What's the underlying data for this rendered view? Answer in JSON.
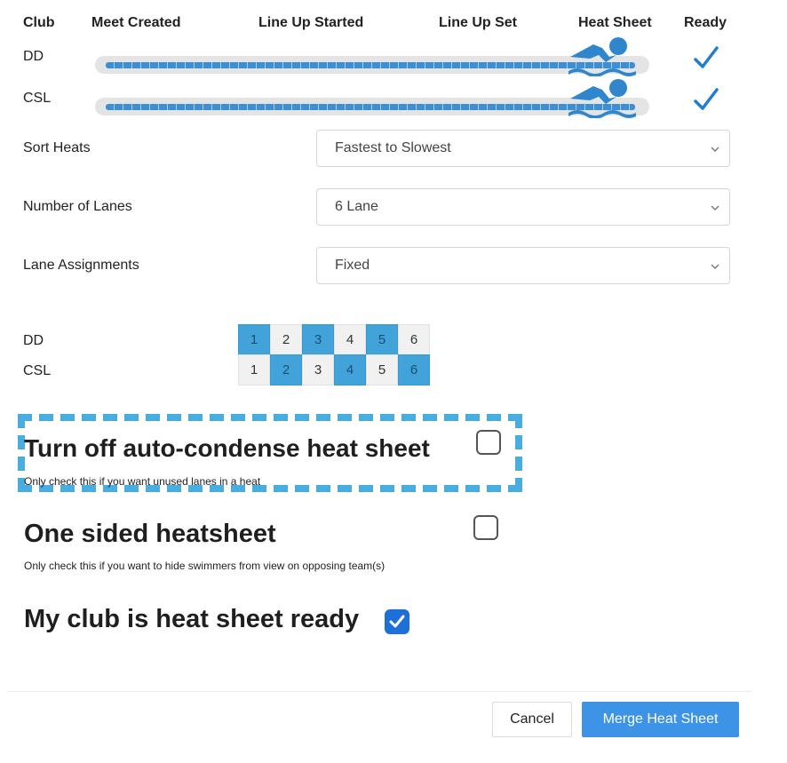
{
  "headers": {
    "club": "Club",
    "meet_created": "Meet Created",
    "lineup_started": "Line Up Started",
    "lineup_set": "Line Up Set",
    "heat_sheet": "Heat Sheet",
    "ready": "Ready"
  },
  "clubs": [
    {
      "name": "DD",
      "progress": 1.0,
      "ready": true
    },
    {
      "name": "CSL",
      "progress": 1.0,
      "ready": true
    }
  ],
  "settings": {
    "sort_heats": {
      "label": "Sort Heats",
      "value": "Fastest to Slowest"
    },
    "num_lanes": {
      "label": "Number of Lanes",
      "value": "6 Lane"
    },
    "lane_assignments": {
      "label": "Lane Assignments",
      "value": "Fixed"
    }
  },
  "lanes": {
    "numbers": [
      "1",
      "2",
      "3",
      "4",
      "5",
      "6"
    ],
    "rows": [
      {
        "club": "DD",
        "selected": [
          1,
          3,
          5
        ]
      },
      {
        "club": "CSL",
        "selected": [
          2,
          4,
          6
        ]
      }
    ]
  },
  "options": {
    "auto_condense": {
      "label": "Turn off auto-condense heat sheet",
      "hint": "Only check this if you want unused lanes in a heat",
      "checked": false
    },
    "one_sided": {
      "label": "One sided heatsheet",
      "hint": "Only check this if you want to hide swimmers from view on opposing team(s)",
      "checked": false
    },
    "club_ready": {
      "label": "My club is heat sheet ready",
      "checked": true
    }
  },
  "buttons": {
    "cancel": "Cancel",
    "merge": "Merge Heat Sheet"
  },
  "colors": {
    "accent": "#3d94e6",
    "lane_selected": "#41a3d9",
    "highlight_dash": "#4bace0",
    "progress": "#3c8fd4"
  },
  "icons": {
    "swimmer": "swimmer-icon",
    "check": "checkmark-icon",
    "chevron": "chevron-down-icon"
  }
}
